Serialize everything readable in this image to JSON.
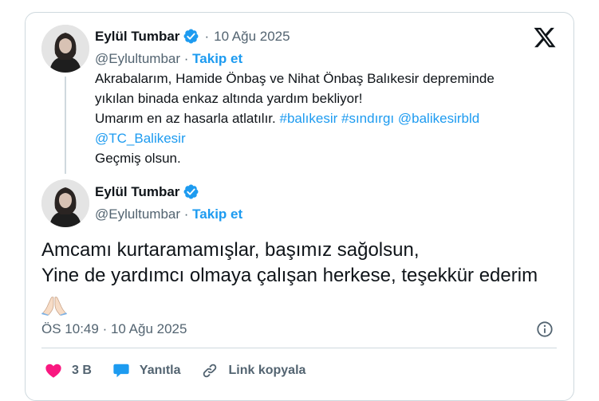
{
  "first_tweet": {
    "author_name": "Eylül Tumbar",
    "date": "10 Ağu 2025",
    "handle": "@Eylultumbar",
    "separator": "·",
    "follow_label": "Takip et",
    "text_lines": [
      "Akrabalarım, Hamide Önbaş ve Nihat Önbaş Balıkesir depreminde",
      "yıkılan binada enkaz altında yardım bekliyor!",
      "Umarım en az hasarla atlatılır."
    ],
    "hashtags": [
      "#balıkesir",
      "#sındırgı"
    ],
    "mentions": [
      "@balikesirbld",
      "@TC_Balikesir"
    ],
    "closing": "Geçmiş olsun."
  },
  "reply_tweet": {
    "author_name": "Eylül Tumbar",
    "handle": "@Eylultumbar",
    "separator": "·",
    "follow_label": "Takip et",
    "text_lines": [
      "Amcamı kurtaramamışlar, başımız sağolsun,",
      "Yine de yardımcı olmaya çalışan herkese, teşekkür ederim"
    ],
    "emoji": "folded-hands",
    "time": "ÖS 10:49",
    "date": "10 Ağu 2025"
  },
  "actions": {
    "like_count": "3 B",
    "reply_label": "Yanıtla",
    "copy_link_label": "Link kopyala"
  },
  "colors": {
    "accent": "#1d9bf0",
    "text": "#0f1419",
    "muted": "#536471",
    "border": "#cfd9de",
    "like": "#f91880"
  },
  "icons": [
    "x-logo-icon",
    "verified-badge-icon",
    "info-icon",
    "heart-icon",
    "reply-icon",
    "link-icon"
  ]
}
